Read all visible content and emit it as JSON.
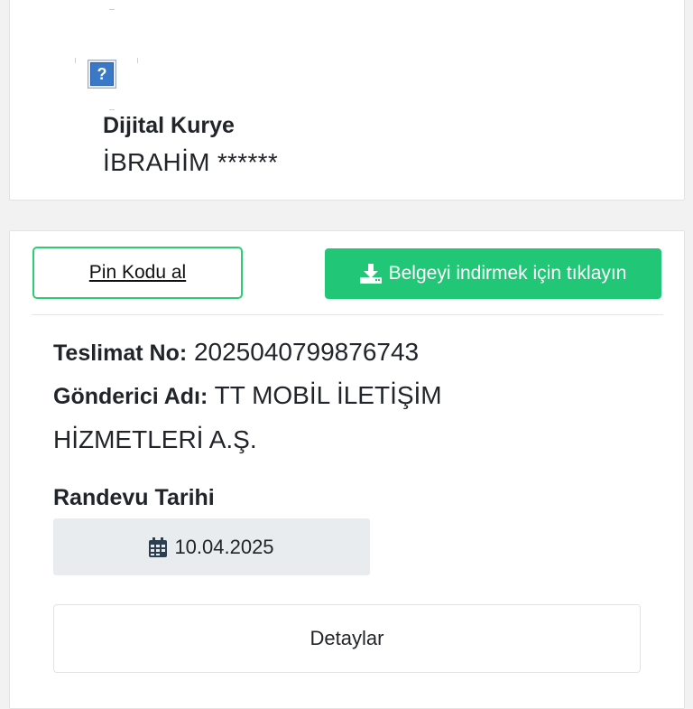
{
  "courier": {
    "title": "Dijital Kurye",
    "name": "İBRAHİM ******",
    "avatar_icon": "question-mark-icon",
    "avatar_glyph": "?"
  },
  "actions": {
    "pin_label": "Pin Kodu al",
    "download_label": "Belgeyi indirmek için tıklayın",
    "download_icon": "download-icon"
  },
  "delivery": {
    "teslimat_label": "Teslimat No",
    "teslimat_value": "2025040799876743",
    "gonderici_label": "Gönderici Adı",
    "gonderici_value": "TT MOBİL İLETİŞİM HİZMETLERİ A.Ş.",
    "randevu_label": "Randevu Tarihi",
    "randevu_date": "10.04.2025",
    "calendar_icon": "calendar-icon",
    "details_label": "Detaylar"
  },
  "colors": {
    "accent_green": "#21c777",
    "pin_border": "#2ecc71",
    "date_bg": "#e9ecef"
  }
}
